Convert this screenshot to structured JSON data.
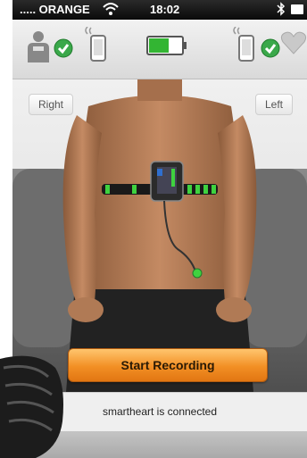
{
  "status_bar": {
    "carrier": "..... ORANGE",
    "time": "18:02",
    "icons": [
      "wifi-icon",
      "bluetooth-icon",
      "battery-icon"
    ]
  },
  "header": {
    "icons": [
      "person-icon",
      "check-icon",
      "phone-icon",
      "battery-icon",
      "phone-icon",
      "check-icon",
      "heart-icon"
    ],
    "device_battery_level": 0.6,
    "colors": {
      "check": "#3aa84a",
      "battery": "#33b533"
    }
  },
  "body_view": {
    "right_label": "Right",
    "left_label": "Left"
  },
  "actions": {
    "record_label": "Start Recording"
  },
  "status": {
    "connection": "smartheart is connected"
  },
  "colors": {
    "record_button": "#f28f24",
    "strap_led": "#3fd23f"
  }
}
